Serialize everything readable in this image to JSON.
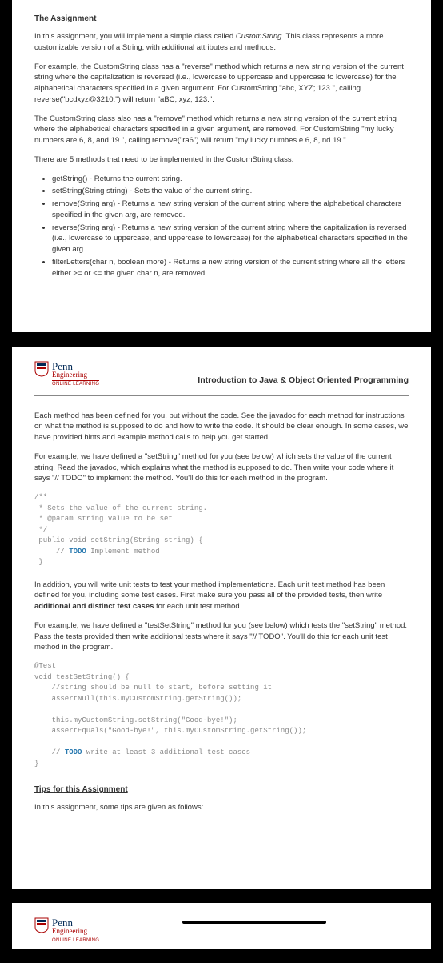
{
  "page1": {
    "title": "The Assignment",
    "p1_a": "In this assignment, you will implement a simple class called ",
    "p1_b": "CustomString",
    "p1_c": ".  This class represents a more customizable version of a String, with additional attributes and methods.",
    "p2": "For example, the CustomString class has a \"reverse\" method which returns a new string version of the current string where the capitalization is reversed (i.e., lowercase to uppercase and uppercase to lowercase) for the alphabetical characters specified in a given argument.  For CustomString \"abc, XYZ; 123.\", calling reverse(\"bcdxyz@3210.\") will return \"aBC, xyz; 123.\".",
    "p3": "The CustomString class also has a \"remove\" method which returns a new string version of the current string where the alphabetical characters specified in a given argument, are removed.  For CustomString \"my lucky numbers are 6, 8, and 19.\", calling remove(\"ra6\") will return \"my lucky numbes e 6, 8, nd 19.\".",
    "p4": "There are 5 methods that need to be implemented in the CustomString class:",
    "bullets": [
      "getString() - Returns the current string.",
      "setString(String string) - Sets the value of the current string.",
      "remove(String arg) - Returns a new string version of the current string where the alphabetical characters specified in the given arg, are removed.",
      "reverse(String arg) - Returns a new string version of the current string where the capitalization is reversed (i.e., lowercase to uppercase, and uppercase to lowercase) for the alphabetical characters specified in the given arg.",
      "filterLetters(char n, boolean more) - Returns a new string version of the current string where all the letters either >= or <= the given char n, are removed."
    ]
  },
  "header": {
    "penn": "Penn",
    "eng": "Engineering",
    "online": "ONLINE LEARNING",
    "course": "Introduction to Java & Object Oriented Programming"
  },
  "page2": {
    "p1": "Each method has been defined for you, but without the code. See the javadoc for each method for instructions on what the method is supposed to do and how to write the code. It should be clear enough.  In some cases, we have provided hints and example method calls to help you get started.",
    "p2": "For example, we have defined a \"setString\" method for you (see below) which sets the value of the current string.  Read the javadoc, which explains what the method is supposed to do.  Then write your code where it says \"// TODO\" to implement the method.  You'll do this for each method in the program.",
    "code1_l1": "/**",
    "code1_l2": " * Sets the value of the current string.",
    "code1_l3": " * @param string value to be set",
    "code1_l4": " */",
    "code1_l5": " public void setString(String string) {",
    "code1_l6a": "     // ",
    "code1_l6b": "TODO",
    "code1_l6c": " Implement method",
    "code1_l7": " }",
    "p3_a": "In addition, you will write unit tests to test your method implementations.  Each unit test method has been defined for you, including some test cases.  First make sure you pass all of the provided tests, then write ",
    "p3_b": "additional and distinct test cases",
    "p3_c": " for each unit test method.",
    "p4": "For example, we have defined a \"testSetString\" method for you (see below) which tests the \"setString\" method.  Pass the tests provided then write additional tests where it says \"// TODO\".  You'll do this for each unit test method in the program.",
    "code2_l1": "@Test",
    "code2_l2": "void testSetString() {",
    "code2_l3": "    //string should be null to start, before setting it",
    "code2_l4": "    assertNull(this.myCustomString.getString());",
    "code2_l5": "",
    "code2_l6": "    this.myCustomString.setString(\"Good-bye!\");",
    "code2_l7": "    assertEquals(\"Good-bye!\", this.myCustomString.getString());",
    "code2_l8": "",
    "code2_l9a": "    // ",
    "code2_l9b": "TODO",
    "code2_l9c": " write at least 3 additional test cases",
    "code2_l10": "}",
    "tips_title": "Tips for this Assignment",
    "tips_p1": "In this assignment, some tips are given as follows:"
  }
}
